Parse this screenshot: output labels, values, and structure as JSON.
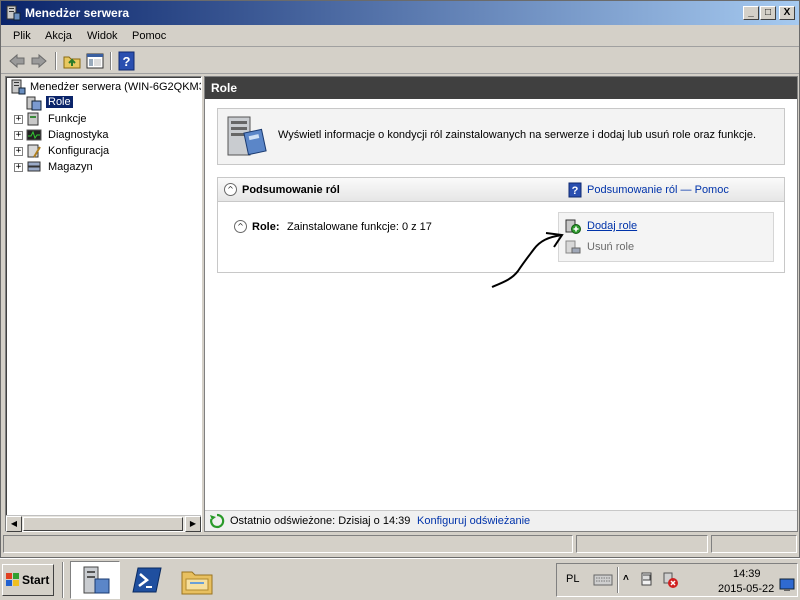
{
  "window": {
    "title": "Menedżer serwera",
    "controls": {
      "minimize": "_",
      "restore": "□",
      "close": "X"
    }
  },
  "menu": [
    "Plik",
    "Akcja",
    "Widok",
    "Pomoc"
  ],
  "toolbar": {
    "icons": [
      "back-arrow-icon",
      "forward-arrow-icon",
      "up-folder-icon",
      "show-hide-tree-icon",
      "help-icon"
    ]
  },
  "tree": {
    "root": "Menedżer serwera (WIN-6G2QKM3",
    "items": [
      {
        "label": "Role",
        "selected": true,
        "expandable": false
      },
      {
        "label": "Funkcje",
        "expandable": true
      },
      {
        "label": "Diagnostyka",
        "expandable": true
      },
      {
        "label": "Konfiguracja",
        "expandable": true
      },
      {
        "label": "Magazyn",
        "expandable": true
      }
    ],
    "expand_glyph": "+"
  },
  "content": {
    "header": "Role",
    "info_text": "Wyświetl informacje o kondycji ról zainstalowanych na serwerze i dodaj lub usuń role oraz funkcje.",
    "summary": {
      "title": "Podsumowanie ról",
      "help_link": "Podsumowanie ról — Pomoc",
      "role_label": "Role:",
      "installed_text": "Zainstalowane funkcje: 0 z 17",
      "collapse_glyph": "^",
      "actions": {
        "add": "Dodaj role",
        "remove": "Usuń role"
      }
    },
    "status": {
      "refresh_text": "Ostatnio odświeżone: Dzisiaj o 14:39",
      "configure_link": "Konfiguruj odświeżanie"
    }
  },
  "taskbar": {
    "start": "Start",
    "language": "PL",
    "time": "14:39",
    "date": "2015-05-22"
  },
  "colors": {
    "title_start": "#0a246a",
    "title_end": "#a6caf0",
    "selection": "#0a246a",
    "link": "#0033aa",
    "pane_header": "#404040"
  }
}
